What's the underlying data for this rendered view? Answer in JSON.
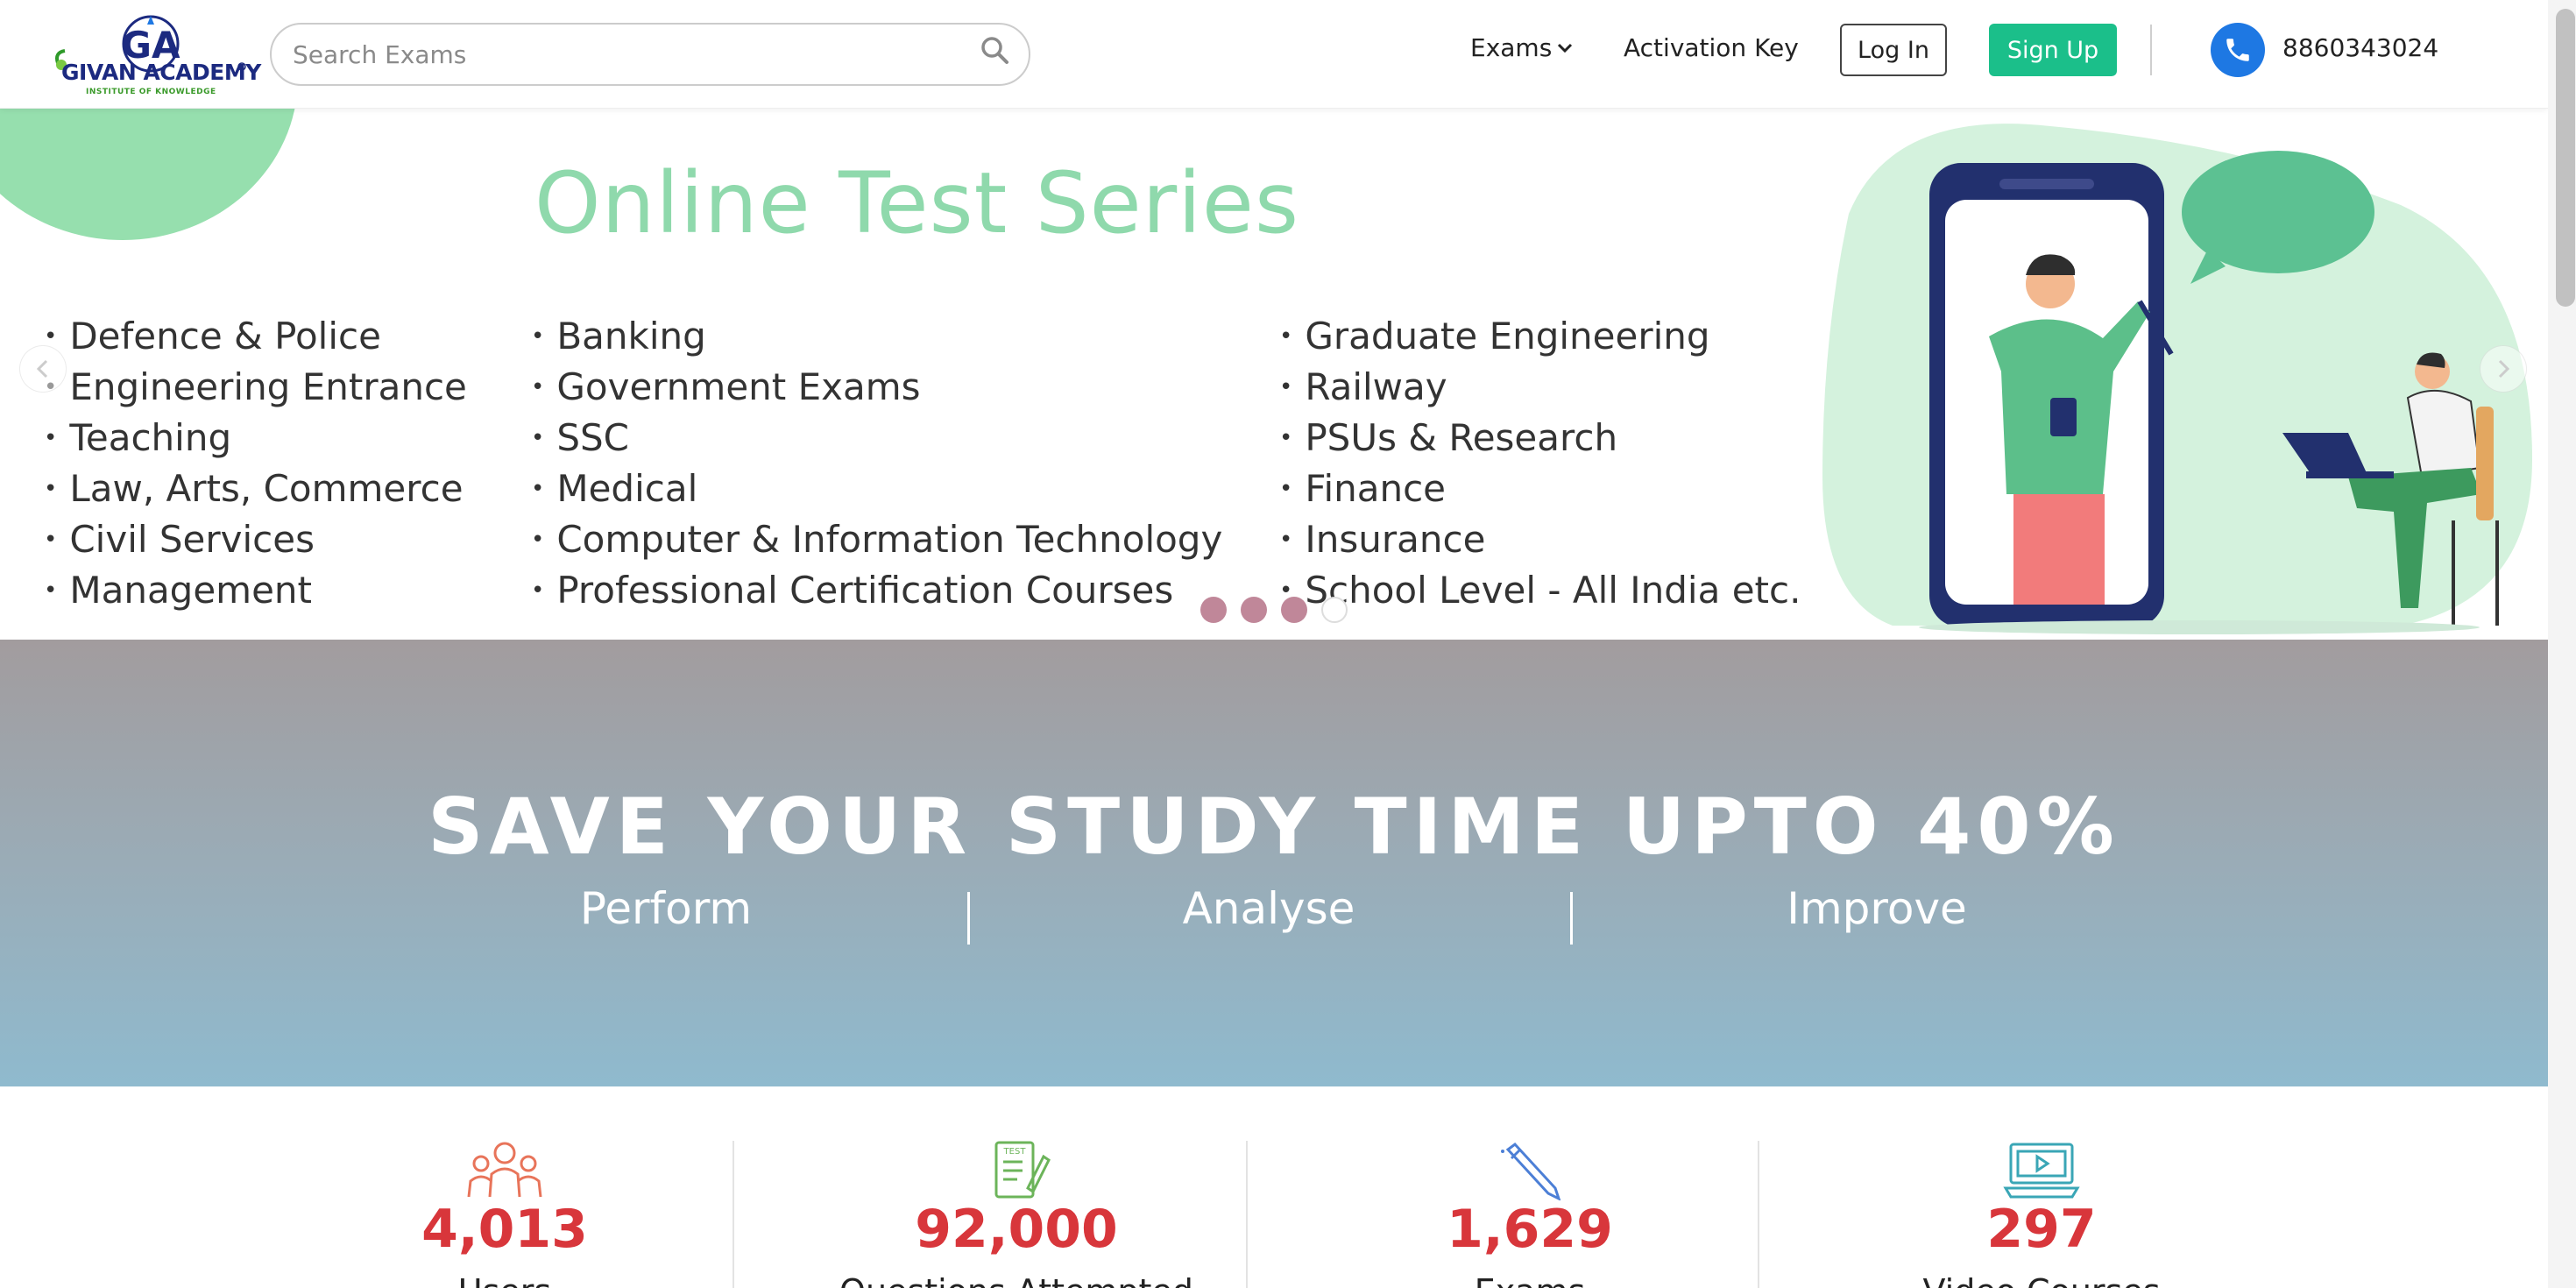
{
  "header": {
    "logo_text": "GIVAN ACADEMY",
    "logo_tagline": "INSTITUTE OF KNOWLEDGE",
    "search_placeholder": "Search Exams",
    "nav": {
      "exams_label": "Exams",
      "activation_label": "Activation Key",
      "login_label": "Log In",
      "signup_label": "Sign Up"
    },
    "phone": "8860343024"
  },
  "banner": {
    "title": "Online Test Series",
    "columns": [
      [
        "Defence & Police",
        "Engineering Entrance",
        "Teaching",
        "Law, Arts, Commerce",
        "Civil Services",
        "Management"
      ],
      [
        "Banking",
        "Government Exams",
        "SSC",
        "Medical",
        "Computer & Information Technology",
        "Professional Certification Courses"
      ],
      [
        "Graduate Engineering",
        "Railway",
        "PSUs & Research",
        "Finance",
        "Insurance",
        "School Level - All India etc."
      ]
    ],
    "slide_count": 4,
    "active_slide": 4
  },
  "study": {
    "title": "SAVE YOUR STUDY TIME UPTO 40%",
    "pillars": [
      "Perform",
      "Analyse",
      "Improve"
    ]
  },
  "stats": [
    {
      "value": "4,013",
      "label": "Users",
      "icon": "users-icon"
    },
    {
      "value": "92,000",
      "label": "Questions Attempted",
      "icon": "test-icon"
    },
    {
      "value": "1,629",
      "label": "Exams",
      "icon": "pen-icon"
    },
    {
      "value": "297",
      "label": "Video Courses",
      "icon": "video-icon"
    }
  ],
  "colors": {
    "signup_green": "#1bbf8a",
    "phone_blue": "#1e78e3",
    "stat_red": "#d8363b",
    "banner_green": "#8fd9ac"
  }
}
